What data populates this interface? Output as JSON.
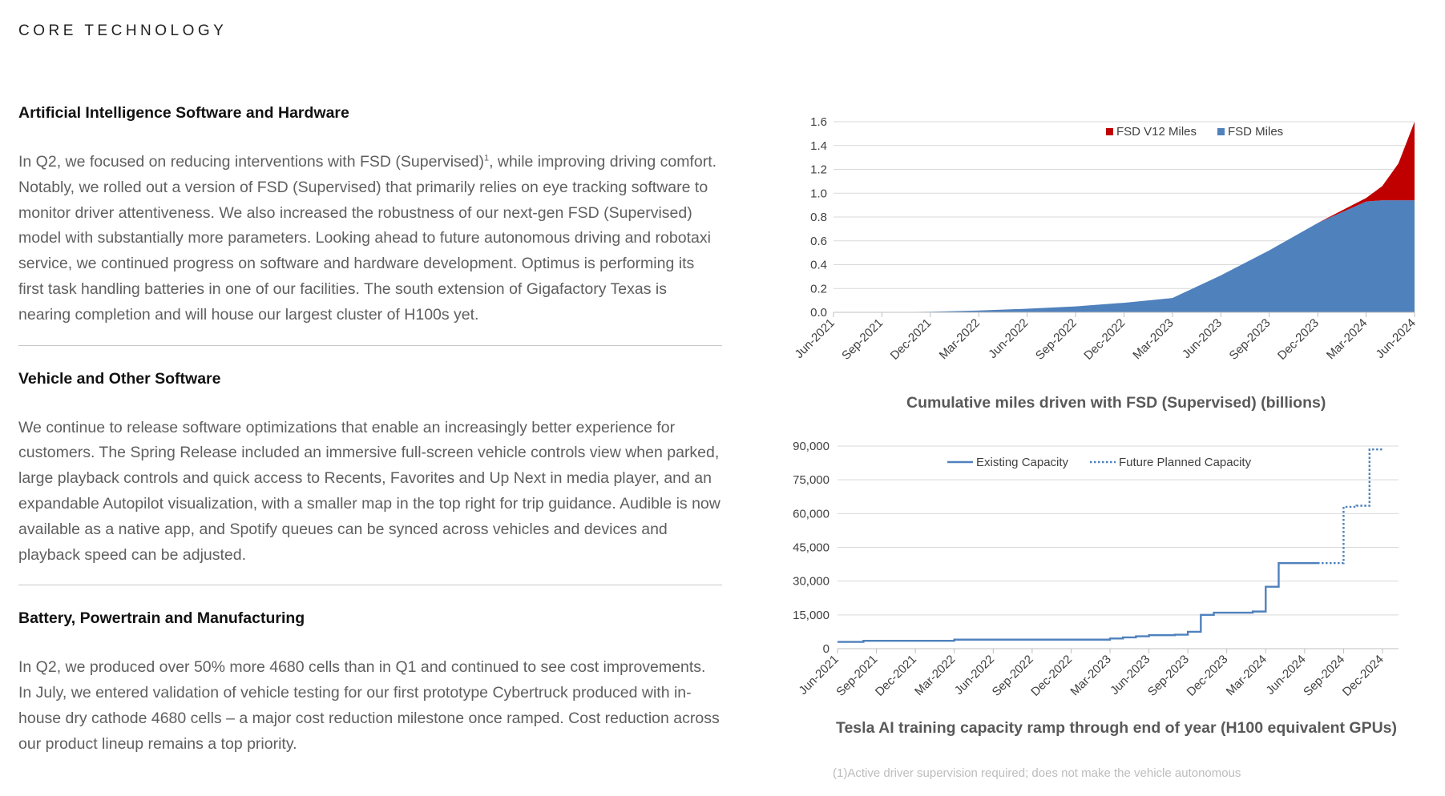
{
  "header": {
    "title": "CORE TECHNOLOGY"
  },
  "sections": [
    {
      "title": "Artificial Intelligence Software and Hardware",
      "body_before_sup": "In Q2, we focused on reducing interventions with FSD (Supervised)",
      "sup": "1",
      "body_after_sup": ", while improving driving comfort. Notably, we rolled out a version of FSD (Supervised) that primarily relies on eye tracking software to monitor driver attentiveness. We also increased the robustness of our next-gen FSD (Supervised) model with substantially more parameters. Looking ahead to future autonomous driving and robotaxi service, we continued progress on software and hardware development. Optimus is performing its first task handling batteries in one of our facilities. The south extension of Gigafactory Texas is nearing completion and will house our largest cluster of H100s yet."
    },
    {
      "title": "Vehicle and Other Software",
      "body": "We continue to release software optimizations that enable an increasingly better experience for customers. The Spring Release included an immersive full-screen vehicle controls view when parked, large playback controls and quick access to Recents, Favorites and Up Next in media player, and an expandable Autopilot visualization, with a smaller map in the top right for trip guidance. Audible is now available as a native app, and Spotify queues can be synced across vehicles and devices and playback speed can be adjusted."
    },
    {
      "title": "Battery, Powertrain and Manufacturing",
      "body": "In Q2, we produced over 50% more 4680 cells than in Q1 and continued to see cost improvements. In July, we entered validation of vehicle testing for our first prototype Cybertruck produced with in-house dry cathode 4680 cells – a major cost reduction milestone once ramped. Cost reduction across our product lineup remains a top priority."
    }
  ],
  "footnote": "(1)Active driver supervision required; does not make the vehicle autonomous",
  "chart_data": [
    {
      "type": "area",
      "title": "Cumulative miles driven with FSD (Supervised) (billions)",
      "x": [
        "Jun-2021",
        "Sep-2021",
        "Dec-2021",
        "Mar-2022",
        "Jun-2022",
        "Sep-2022",
        "Dec-2022",
        "Mar-2023",
        "Jun-2023",
        "Sep-2023",
        "Dec-2023",
        "Mar-2024",
        "Apr-2024",
        "May-2024",
        "Jun-2024"
      ],
      "x_ticks": [
        "Jun-2021",
        "Sep-2021",
        "Dec-2021",
        "Mar-2022",
        "Jun-2022",
        "Sep-2022",
        "Dec-2022",
        "Mar-2023",
        "Jun-2023",
        "Sep-2023",
        "Dec-2023",
        "Mar-2024",
        "Jun-2024"
      ],
      "y_ticks": [
        "0.0",
        "0.2",
        "0.4",
        "0.6",
        "0.8",
        "1.0",
        "1.2",
        "1.4",
        "1.6"
      ],
      "ylim": [
        0,
        1.6
      ],
      "stacked": true,
      "legend_position": "top-center",
      "grid": true,
      "series": [
        {
          "name": "FSD Miles",
          "color": "#4f81bd",
          "values": [
            0.0,
            0.0,
            0.005,
            0.015,
            0.03,
            0.05,
            0.08,
            0.12,
            0.31,
            0.52,
            0.75,
            0.93,
            0.94,
            0.94,
            0.94
          ]
        },
        {
          "name": "FSD V12 Miles",
          "color": "#c00000",
          "values": [
            0,
            0,
            0,
            0,
            0,
            0,
            0,
            0,
            0,
            0,
            0,
            0.03,
            0.12,
            0.31,
            0.66
          ]
        }
      ]
    },
    {
      "type": "line",
      "title": "Tesla AI training capacity ramp through end of year (H100 equivalent GPUs)",
      "x_ticks": [
        "Jun-2021",
        "Sep-2021",
        "Dec-2021",
        "Mar-2022",
        "Jun-2022",
        "Sep-2022",
        "Dec-2022",
        "Mar-2023",
        "Jun-2023",
        "Sep-2023",
        "Dec-2023",
        "Mar-2024",
        "Jun-2024",
        "Sep-2024",
        "Dec-2024"
      ],
      "y_ticks": [
        "0",
        "15,000",
        "30,000",
        "45,000",
        "60,000",
        "75,000",
        "90,000"
      ],
      "ylim": [
        0,
        90000
      ],
      "legend_position": "top-center",
      "grid": true,
      "step": true,
      "series": [
        {
          "name": "Existing Capacity",
          "color": "#4f81bd",
          "dash": "solid",
          "points": [
            [
              "Jun-2021",
              3000
            ],
            [
              "Aug-2021",
              3500
            ],
            [
              "Mar-2022",
              4000
            ],
            [
              "Mar-2023",
              4500
            ],
            [
              "Apr-2023",
              5000
            ],
            [
              "May-2023",
              5500
            ],
            [
              "Jun-2023",
              6000
            ],
            [
              "Aug-2023",
              6200
            ],
            [
              "Sep-2023",
              7500
            ],
            [
              "Oct-2023",
              15000
            ],
            [
              "Nov-2023",
              16000
            ],
            [
              "Feb-2024",
              16500
            ],
            [
              "Mar-2024",
              27500
            ],
            [
              "Apr-2024",
              38000
            ],
            [
              "Jul-2024",
              38000
            ]
          ]
        },
        {
          "name": "Future Planned Capacity",
          "color": "#4f81bd",
          "dash": "dotted",
          "points": [
            [
              "Jul-2024",
              38000
            ],
            [
              "Aug-2024",
              38000
            ],
            [
              "Sep-2024",
              63000
            ],
            [
              "Oct-2024",
              63500
            ],
            [
              "Nov-2024",
              88500
            ],
            [
              "Dec-2024",
              88500
            ]
          ]
        }
      ]
    }
  ]
}
